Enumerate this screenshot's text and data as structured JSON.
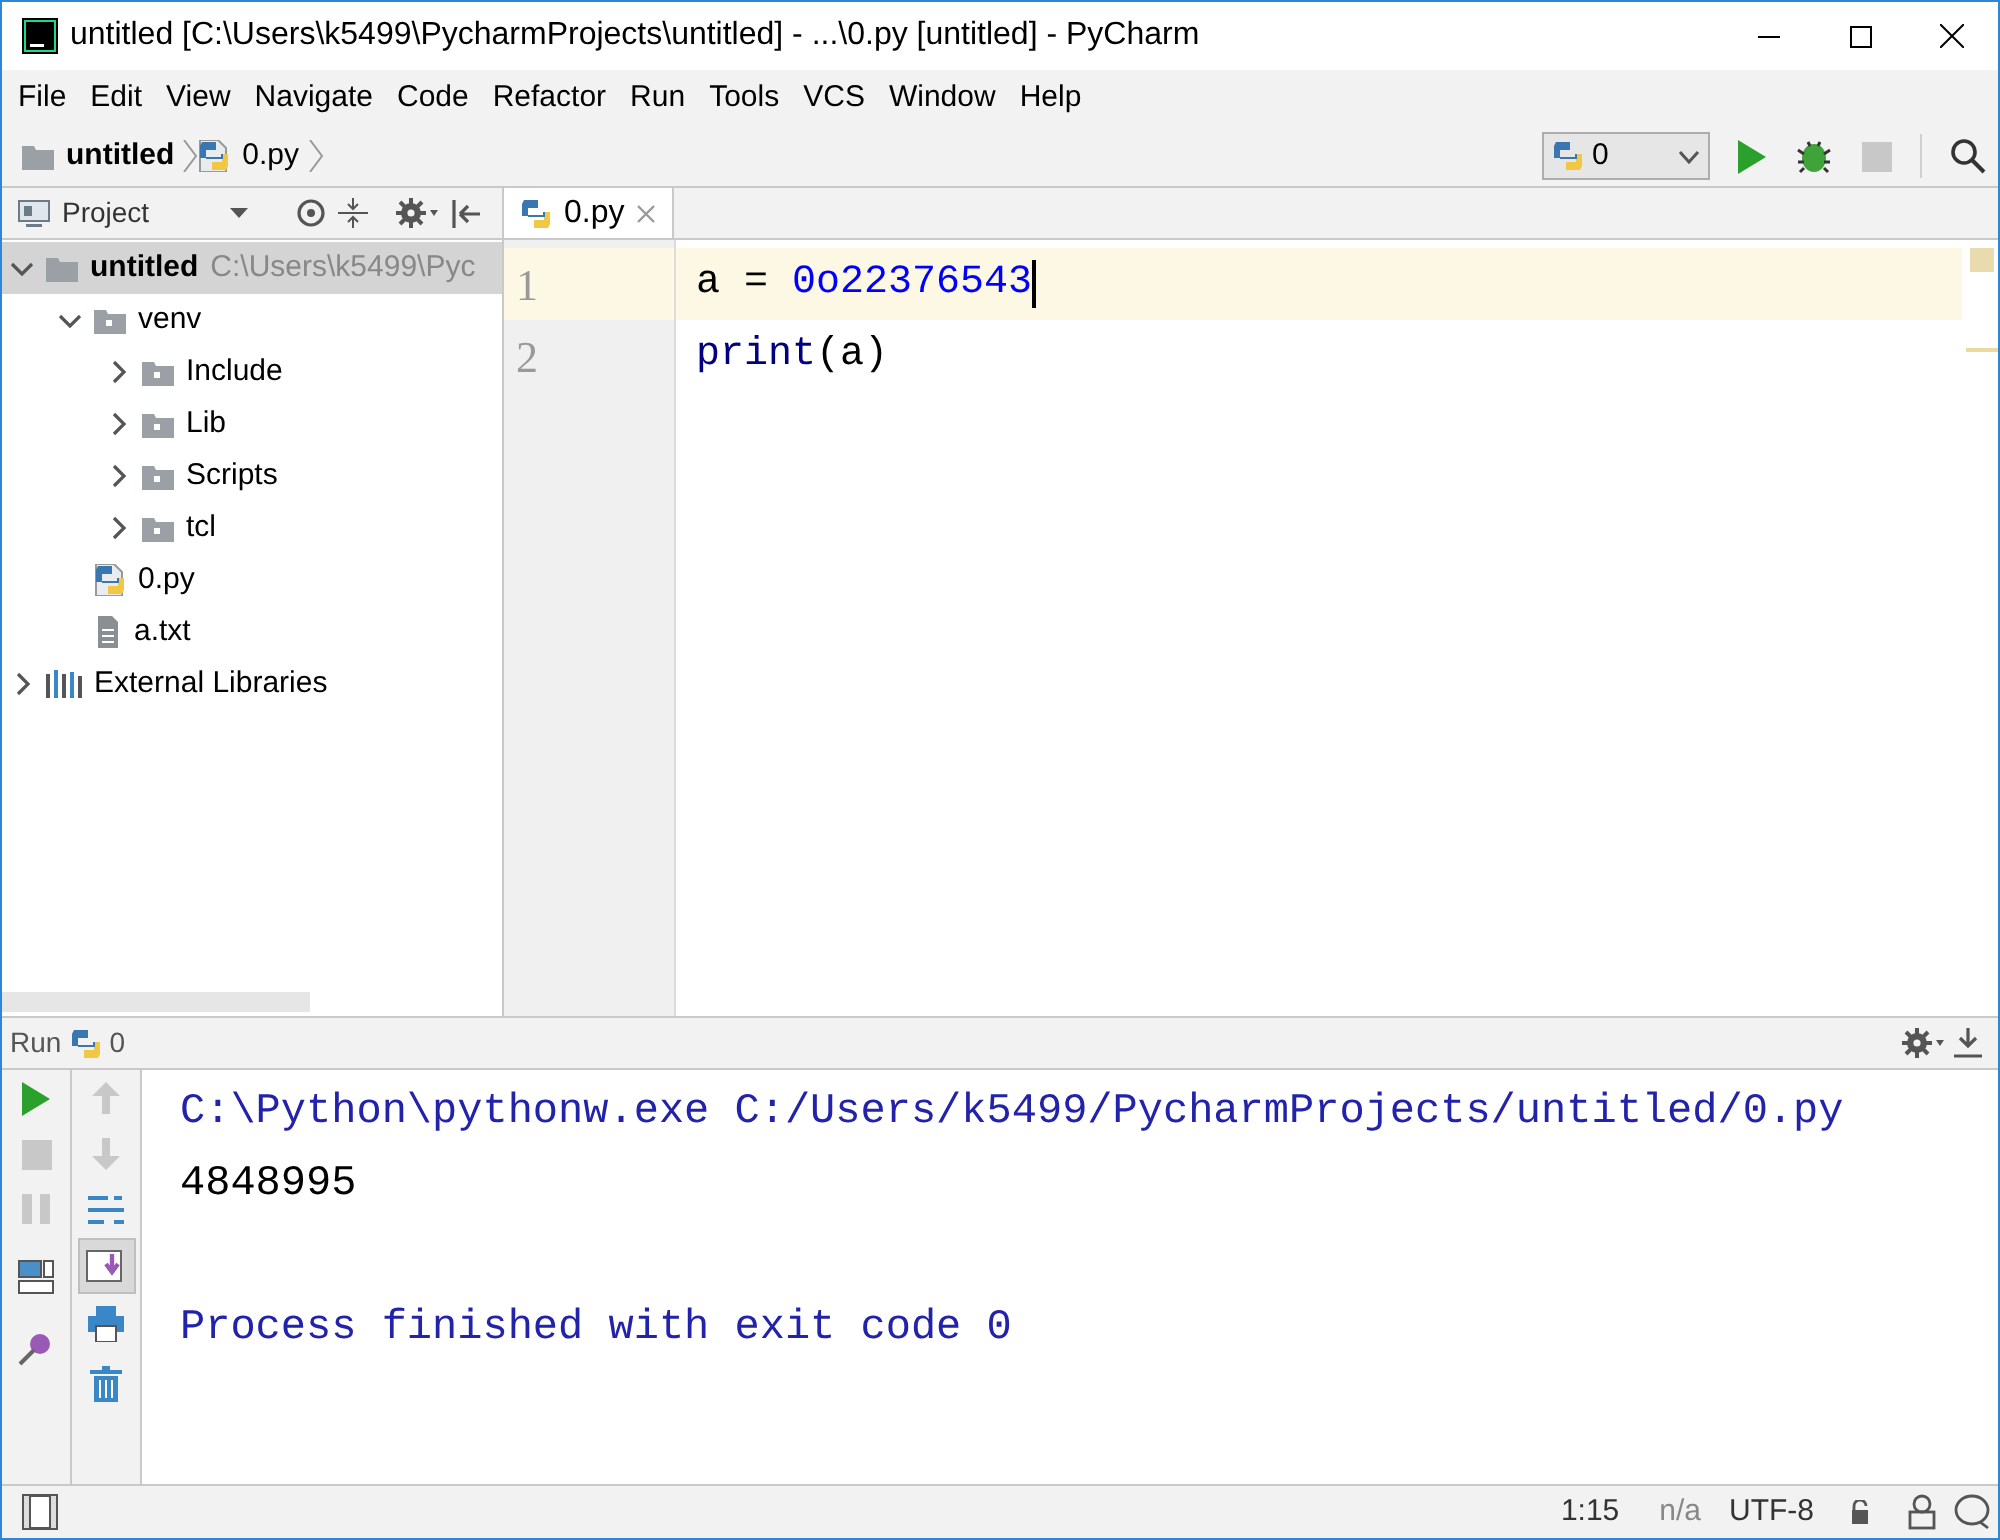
{
  "window": {
    "title": "untitled [C:\\Users\\k5499\\PycharmProjects\\untitled] - ...\\0.py [untitled] - PyCharm"
  },
  "menu": [
    "File",
    "Edit",
    "View",
    "Navigate",
    "Code",
    "Refactor",
    "Run",
    "Tools",
    "VCS",
    "Window",
    "Help"
  ],
  "breadcrumbs": [
    {
      "label": "untitled",
      "kind": "folder"
    },
    {
      "label": "0.py",
      "kind": "python"
    }
  ],
  "run_config": {
    "label": "0"
  },
  "project_panel": {
    "title": "Project",
    "tree": [
      {
        "label": "untitled",
        "path": "C:\\Users\\k5499\\Pyc",
        "kind": "folder",
        "expanded": true,
        "selected": true,
        "children": [
          {
            "label": "venv",
            "kind": "package",
            "expanded": true,
            "selected": false,
            "children": [
              {
                "label": "Include",
                "kind": "package",
                "expanded": false,
                "selected": false
              },
              {
                "label": "Lib",
                "kind": "package",
                "expanded": false,
                "selected": false
              },
              {
                "label": "Scripts",
                "kind": "package",
                "expanded": false,
                "selected": false
              },
              {
                "label": "tcl",
                "kind": "package",
                "expanded": false,
                "selected": false
              }
            ]
          },
          {
            "label": "0.py",
            "kind": "python",
            "selected": false
          },
          {
            "label": "a.txt",
            "kind": "text",
            "selected": false
          }
        ]
      },
      {
        "label": "External Libraries",
        "kind": "libraries",
        "expanded": false,
        "selected": false
      }
    ]
  },
  "editor_tabs": [
    {
      "label": "0.py",
      "selected": true
    }
  ],
  "editor": {
    "lines": [
      {
        "number": "1",
        "current": true,
        "tokens": [
          {
            "text": "a = ",
            "kind": "plain"
          },
          {
            "text": "0o22376543",
            "kind": "number"
          }
        ]
      },
      {
        "number": "2",
        "current": false,
        "tokens": [
          {
            "text": "print",
            "kind": "builtin"
          },
          {
            "text": "(a)",
            "kind": "plain"
          }
        ]
      }
    ]
  },
  "run_panel": {
    "title": "Run",
    "config": "0",
    "console": [
      {
        "text": "C:\\Python\\pythonw.exe C:/Users/k5499/PycharmProjects/untitled/0.py",
        "kind": "system"
      },
      {
        "text": "4848995",
        "kind": "output"
      },
      {
        "text": "Process finished with exit code 0",
        "kind": "system",
        "gap_before": true
      }
    ]
  },
  "status_bar": {
    "position": "1:15",
    "line_separator": "n/a",
    "encoding": "UTF-8"
  }
}
